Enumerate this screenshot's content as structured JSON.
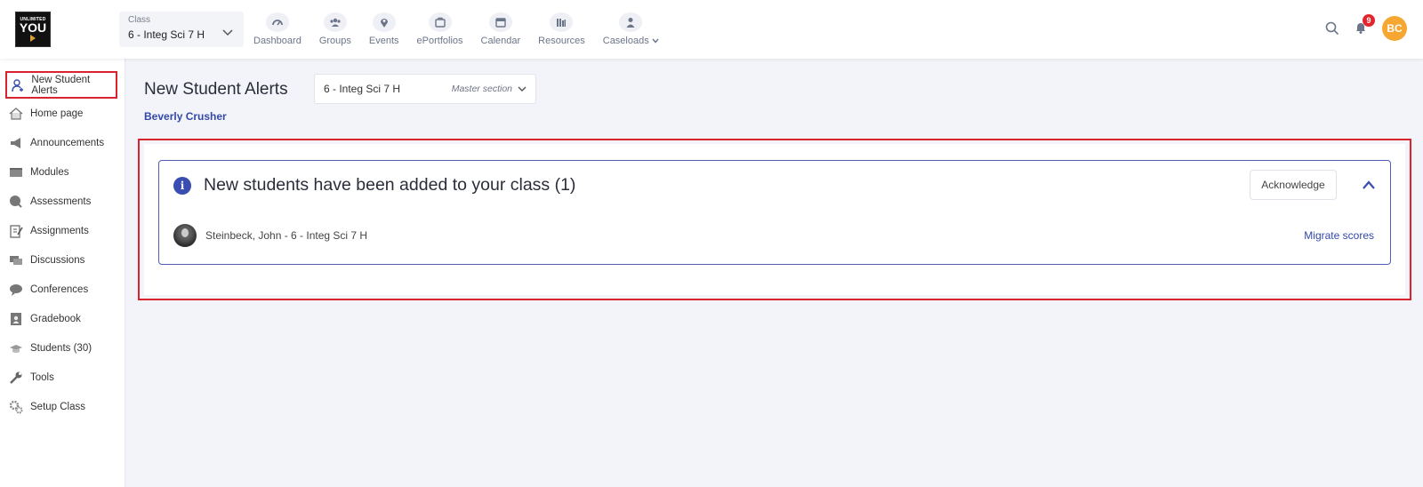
{
  "logo": {
    "line1": "UNLIMITED",
    "line2": "YOU"
  },
  "class_select": {
    "caption": "Class",
    "value": "6 - Integ Sci 7 H"
  },
  "nav": [
    {
      "label": "Dashboard",
      "icon": "gauge-icon"
    },
    {
      "label": "Groups",
      "icon": "groups-icon"
    },
    {
      "label": "Events",
      "icon": "map-pin-icon"
    },
    {
      "label": "ePortfolios",
      "icon": "portfolio-icon"
    },
    {
      "label": "Calendar",
      "icon": "calendar-icon"
    },
    {
      "label": "Resources",
      "icon": "books-icon"
    },
    {
      "label": "Caseloads",
      "icon": "person-icon"
    }
  ],
  "notifications": {
    "count": "9"
  },
  "user": {
    "initials": "BC",
    "color": "#f5a732"
  },
  "sidebar": {
    "items": [
      {
        "label": "New Student Alerts",
        "icon": "add-user-icon",
        "active": true
      },
      {
        "label": "Home page",
        "icon": "home-icon"
      },
      {
        "label": "Announcements",
        "icon": "megaphone-icon"
      },
      {
        "label": "Modules",
        "icon": "folder-icon"
      },
      {
        "label": "Assessments",
        "icon": "assessment-icon"
      },
      {
        "label": "Assignments",
        "icon": "clipboard-icon"
      },
      {
        "label": "Discussions",
        "icon": "chat-icon"
      },
      {
        "label": "Conferences",
        "icon": "conference-icon"
      },
      {
        "label": "Gradebook",
        "icon": "gradebook-icon"
      },
      {
        "label": "Students (30)",
        "icon": "students-icon"
      },
      {
        "label": "Tools",
        "icon": "wrench-icon"
      },
      {
        "label": "Setup Class",
        "icon": "gear-icon"
      }
    ]
  },
  "main": {
    "title": "New Student Alerts",
    "section_select": {
      "value": "6 - Integ Sci 7 H",
      "hint": "Master section"
    },
    "teacher": "Beverly Crusher",
    "alert": {
      "title": "New students have been added to your class (1)",
      "acknowledge_label": "Acknowledge",
      "student": "Steinbeck, John - 6 - Integ Sci 7 H",
      "migrate_label": "Migrate scores"
    }
  },
  "colors": {
    "accent": "#3a4db0",
    "link": "#3349a8",
    "highlight_border": "#d9232e",
    "badge": "#e4242c"
  }
}
